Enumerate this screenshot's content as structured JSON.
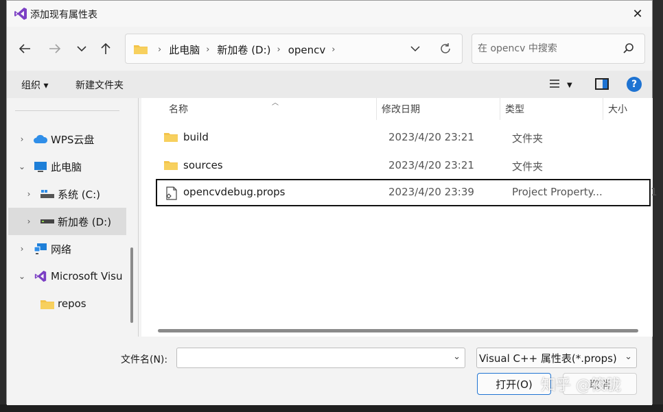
{
  "window": {
    "title": "添加现有属性表"
  },
  "address": {
    "crumbs": [
      "此电脑",
      "新加卷 (D:)",
      "opencv"
    ]
  },
  "search": {
    "placeholder": "在 opencv 中搜索"
  },
  "toolbar": {
    "organize": "组织 ▾",
    "new_folder": "新建文件夹"
  },
  "sidebar": {
    "items": [
      {
        "label": "WPS云盘"
      },
      {
        "label": "此电脑"
      },
      {
        "label": "系统 (C:)"
      },
      {
        "label": "新加卷 (D:)"
      },
      {
        "label": "网络"
      },
      {
        "label": "Microsoft Visu"
      },
      {
        "label": "repos"
      }
    ]
  },
  "columns": {
    "name": "名称",
    "date": "修改日期",
    "type": "类型",
    "size": "大小"
  },
  "files": [
    {
      "name": "build",
      "date": "2023/4/20 23:21",
      "type": "文件夹"
    },
    {
      "name": "sources",
      "date": "2023/4/20 23:21",
      "type": "文件夹"
    },
    {
      "name": "opencvdebug.props",
      "date": "2023/4/20 23:39",
      "type": "Project Property...",
      "size_trunc": "1"
    }
  ],
  "footer": {
    "filename_label": "文件名(N):",
    "filename_value": "",
    "filetype": "Visual C++ 属性表(*.props)",
    "open_label": "打开(O)",
    "cancel_label": "取消"
  },
  "watermark": "知乎 @筱胧",
  "colors": {
    "accent": "#1e73d2",
    "vs_purple": "#7b3fc4",
    "folder": "#f3c44b"
  }
}
